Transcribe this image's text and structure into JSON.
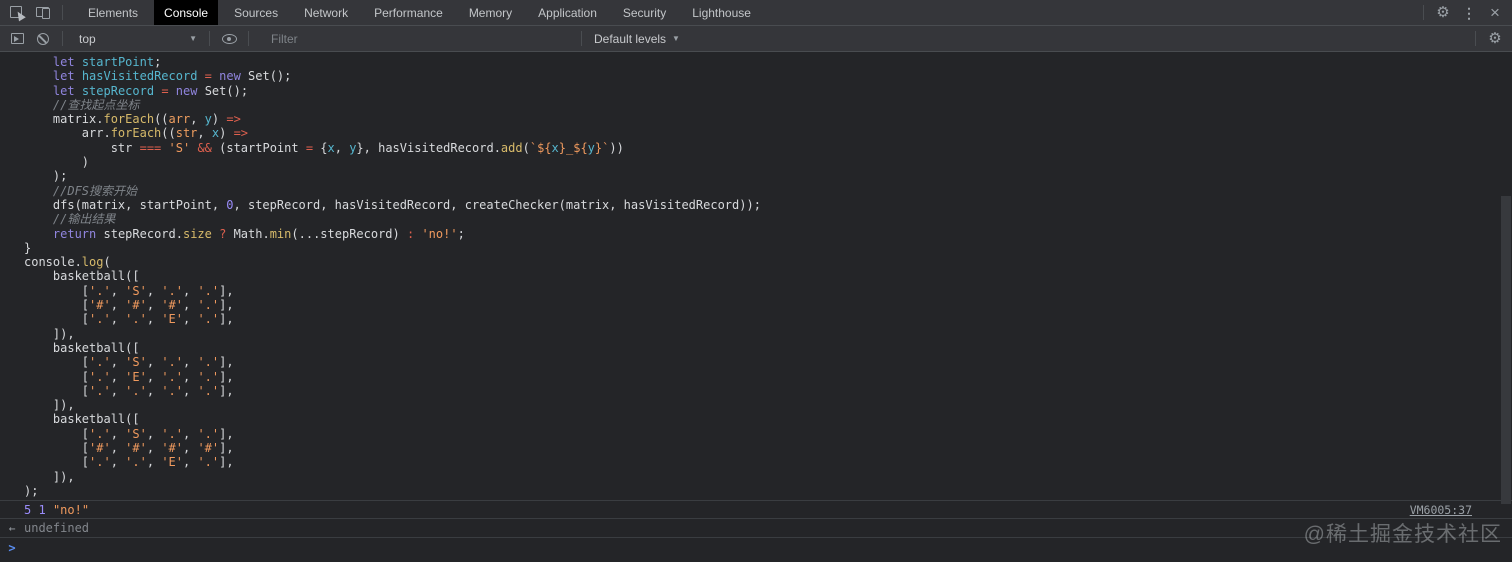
{
  "tabs": [
    "Elements",
    "Console",
    "Sources",
    "Network",
    "Performance",
    "Memory",
    "Application",
    "Security",
    "Lighthouse"
  ],
  "active_tab": "Console",
  "toolbar": {
    "context_selector": "top",
    "filter_placeholder": "Filter",
    "levels_label": "Default levels"
  },
  "icons": {
    "gear": "⚙",
    "kebab": "⋮",
    "close": "×",
    "arrow": "▼",
    "prompt": ">",
    "return_arrow": "←"
  },
  "console": {
    "code_lines": [
      [
        [
          "pl",
          "    "
        ],
        [
          "kw",
          "let"
        ],
        [
          "pl",
          " "
        ],
        [
          "def",
          "startPoint"
        ],
        [
          "pl",
          ";"
        ]
      ],
      [
        [
          "pl",
          "    "
        ],
        [
          "kw",
          "let"
        ],
        [
          "pl",
          " "
        ],
        [
          "def",
          "hasVisitedRecord"
        ],
        [
          "pl",
          " "
        ],
        [
          "op",
          "="
        ],
        [
          "pl",
          " "
        ],
        [
          "kw",
          "new"
        ],
        [
          "pl",
          " Set();"
        ]
      ],
      [
        [
          "pl",
          "    "
        ],
        [
          "kw",
          "let"
        ],
        [
          "pl",
          " "
        ],
        [
          "def",
          "stepRecord"
        ],
        [
          "pl",
          " "
        ],
        [
          "op",
          "="
        ],
        [
          "pl",
          " "
        ],
        [
          "kw",
          "new"
        ],
        [
          "pl",
          " Set();"
        ]
      ],
      [
        [
          "com",
          "    //查找起点坐标"
        ]
      ],
      [
        [
          "pl",
          "    matrix."
        ],
        [
          "prop",
          "forEach"
        ],
        [
          "pl",
          "(("
        ],
        [
          "par",
          "arr"
        ],
        [
          "pl",
          ", "
        ],
        [
          "def",
          "y"
        ],
        [
          "pl",
          ") "
        ],
        [
          "op",
          "=>"
        ]
      ],
      [
        [
          "pl",
          "        arr."
        ],
        [
          "prop",
          "forEach"
        ],
        [
          "pl",
          "(("
        ],
        [
          "par",
          "str"
        ],
        [
          "pl",
          ", "
        ],
        [
          "def",
          "x"
        ],
        [
          "pl",
          ") "
        ],
        [
          "op",
          "=>"
        ]
      ],
      [
        [
          "pl",
          "            str "
        ],
        [
          "op",
          "==="
        ],
        [
          "pl",
          " "
        ],
        [
          "str",
          "'S'"
        ],
        [
          "pl",
          " "
        ],
        [
          "op",
          "&&"
        ],
        [
          "pl",
          " (startPoint "
        ],
        [
          "op",
          "="
        ],
        [
          "pl",
          " {"
        ],
        [
          "def",
          "x"
        ],
        [
          "pl",
          ", "
        ],
        [
          "def",
          "y"
        ],
        [
          "pl",
          "}, hasVisitedRecord."
        ],
        [
          "prop",
          "add"
        ],
        [
          "pl",
          "("
        ],
        [
          "str",
          "`${"
        ],
        [
          "def",
          "x"
        ],
        [
          "str",
          "}_${"
        ],
        [
          "def",
          "y"
        ],
        [
          "str",
          "}`"
        ],
        [
          "pl",
          "))"
        ]
      ],
      [
        [
          "pl",
          "        )"
        ]
      ],
      [
        [
          "pl",
          "    );"
        ]
      ],
      [
        [
          "com",
          "    //DFS搜索开始"
        ]
      ],
      [
        [
          "pl",
          "    dfs(matrix, startPoint, "
        ],
        [
          "num",
          "0"
        ],
        [
          "pl",
          ", stepRecord, hasVisitedRecord, createChecker(matrix, hasVisitedRecord));"
        ]
      ],
      [
        [
          "com",
          "    //输出结果"
        ]
      ],
      [
        [
          "pl",
          "    "
        ],
        [
          "kw",
          "return"
        ],
        [
          "pl",
          " stepRecord."
        ],
        [
          "prop",
          "size"
        ],
        [
          "pl",
          " "
        ],
        [
          "op",
          "?"
        ],
        [
          "pl",
          " Math."
        ],
        [
          "prop",
          "min"
        ],
        [
          "pl",
          "(...stepRecord) "
        ],
        [
          "op",
          ":"
        ],
        [
          "pl",
          " "
        ],
        [
          "str",
          "'no!'"
        ],
        [
          "pl",
          ";"
        ]
      ],
      [
        [
          "pl",
          "}"
        ]
      ],
      [
        [
          "pl",
          "console."
        ],
        [
          "prop",
          "log"
        ],
        [
          "pl",
          "("
        ]
      ],
      [
        [
          "pl",
          "    basketball(["
        ]
      ],
      [
        [
          "pl",
          "        ["
        ],
        [
          "str",
          "'.'"
        ],
        [
          "pl",
          ", "
        ],
        [
          "str",
          "'S'"
        ],
        [
          "pl",
          ", "
        ],
        [
          "str",
          "'.'"
        ],
        [
          "pl",
          ", "
        ],
        [
          "str",
          "'.'"
        ],
        [
          "pl",
          "],"
        ]
      ],
      [
        [
          "pl",
          "        ["
        ],
        [
          "str",
          "'#'"
        ],
        [
          "pl",
          ", "
        ],
        [
          "str",
          "'#'"
        ],
        [
          "pl",
          ", "
        ],
        [
          "str",
          "'#'"
        ],
        [
          "pl",
          ", "
        ],
        [
          "str",
          "'.'"
        ],
        [
          "pl",
          "],"
        ]
      ],
      [
        [
          "pl",
          "        ["
        ],
        [
          "str",
          "'.'"
        ],
        [
          "pl",
          ", "
        ],
        [
          "str",
          "'.'"
        ],
        [
          "pl",
          ", "
        ],
        [
          "str",
          "'E'"
        ],
        [
          "pl",
          ", "
        ],
        [
          "str",
          "'.'"
        ],
        [
          "pl",
          "],"
        ]
      ],
      [
        [
          "pl",
          "    ]),"
        ]
      ],
      [
        [
          "pl",
          "    basketball(["
        ]
      ],
      [
        [
          "pl",
          "        ["
        ],
        [
          "str",
          "'.'"
        ],
        [
          "pl",
          ", "
        ],
        [
          "str",
          "'S'"
        ],
        [
          "pl",
          ", "
        ],
        [
          "str",
          "'.'"
        ],
        [
          "pl",
          ", "
        ],
        [
          "str",
          "'.'"
        ],
        [
          "pl",
          "],"
        ]
      ],
      [
        [
          "pl",
          "        ["
        ],
        [
          "str",
          "'.'"
        ],
        [
          "pl",
          ", "
        ],
        [
          "str",
          "'E'"
        ],
        [
          "pl",
          ", "
        ],
        [
          "str",
          "'.'"
        ],
        [
          "pl",
          ", "
        ],
        [
          "str",
          "'.'"
        ],
        [
          "pl",
          "],"
        ]
      ],
      [
        [
          "pl",
          "        ["
        ],
        [
          "str",
          "'.'"
        ],
        [
          "pl",
          ", "
        ],
        [
          "str",
          "'.'"
        ],
        [
          "pl",
          ", "
        ],
        [
          "str",
          "'.'"
        ],
        [
          "pl",
          ", "
        ],
        [
          "str",
          "'.'"
        ],
        [
          "pl",
          "],"
        ]
      ],
      [
        [
          "pl",
          "    ]),"
        ]
      ],
      [
        [
          "pl",
          "    basketball(["
        ]
      ],
      [
        [
          "pl",
          "        ["
        ],
        [
          "str",
          "'.'"
        ],
        [
          "pl",
          ", "
        ],
        [
          "str",
          "'S'"
        ],
        [
          "pl",
          ", "
        ],
        [
          "str",
          "'.'"
        ],
        [
          "pl",
          ", "
        ],
        [
          "str",
          "'.'"
        ],
        [
          "pl",
          "],"
        ]
      ],
      [
        [
          "pl",
          "        ["
        ],
        [
          "str",
          "'#'"
        ],
        [
          "pl",
          ", "
        ],
        [
          "str",
          "'#'"
        ],
        [
          "pl",
          ", "
        ],
        [
          "str",
          "'#'"
        ],
        [
          "pl",
          ", "
        ],
        [
          "str",
          "'#'"
        ],
        [
          "pl",
          "],"
        ]
      ],
      [
        [
          "pl",
          "        ["
        ],
        [
          "str",
          "'.'"
        ],
        [
          "pl",
          ", "
        ],
        [
          "str",
          "'.'"
        ],
        [
          "pl",
          ", "
        ],
        [
          "str",
          "'E'"
        ],
        [
          "pl",
          ", "
        ],
        [
          "str",
          "'.'"
        ],
        [
          "pl",
          "],"
        ]
      ],
      [
        [
          "pl",
          "    ]),"
        ]
      ],
      [
        [
          "pl",
          ");"
        ]
      ]
    ],
    "result": {
      "values": [
        [
          "num",
          "5"
        ],
        [
          "num",
          "1"
        ],
        [
          "str",
          "\"no!\""
        ]
      ],
      "source_link": "VM6005:37"
    },
    "return_value": "undefined"
  },
  "watermark": "@稀土掘金技术社区",
  "colors": {
    "toolbar_bg": "#35363a",
    "console_bg": "#242528",
    "active_tab_bg": "#000000",
    "keyword": "#9085de",
    "string": "#f09a5e",
    "number": "#9a8cfa",
    "operator": "#de604e",
    "property": "#d7ba6a",
    "variable": "#56b6ce",
    "comment": "#7f848a",
    "link": "#9aa0a6"
  }
}
